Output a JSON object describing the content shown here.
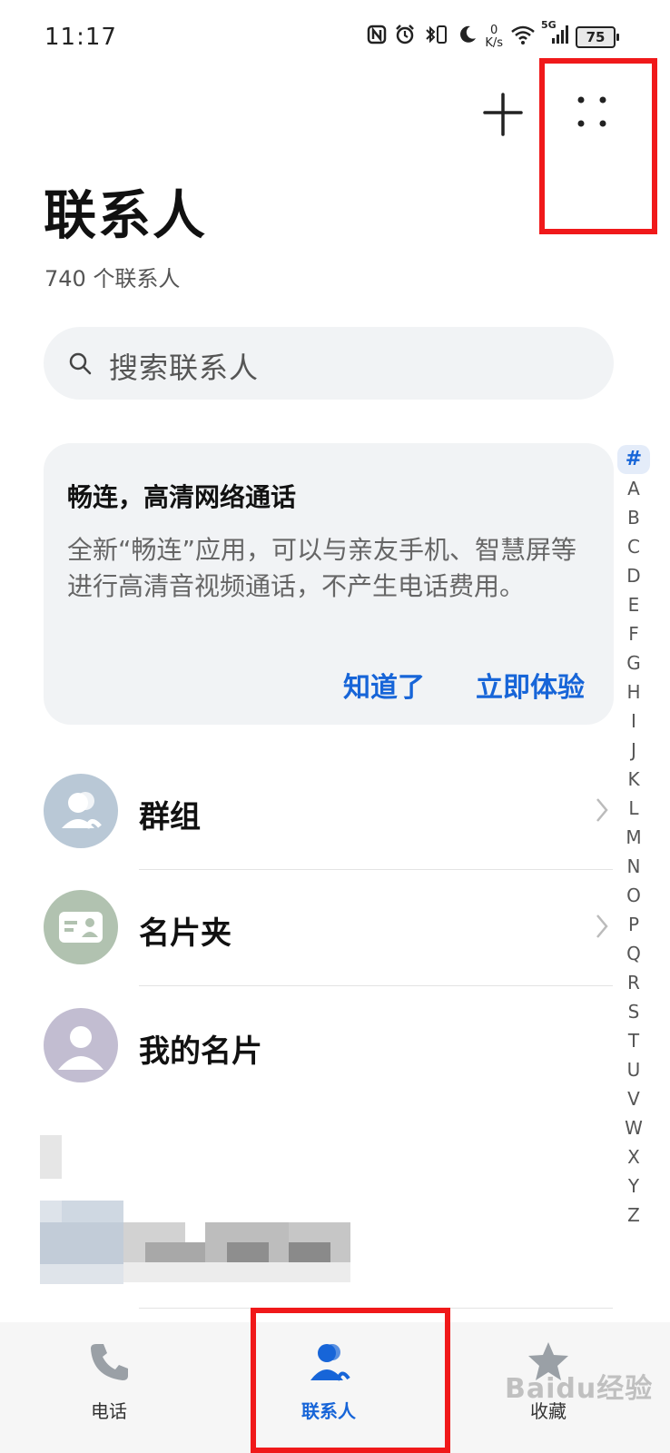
{
  "status_bar": {
    "time": "11:17",
    "net_speed_value": "0",
    "net_speed_unit": "K/s",
    "signal_label": "5G",
    "battery": "75"
  },
  "header": {
    "title": "联系人",
    "subtitle": "740 个联系人",
    "add_icon": "plus-icon",
    "more_icon": "more-icon"
  },
  "search": {
    "placeholder": "搜索联系人"
  },
  "promo_card": {
    "title": "畅连，高清网络通话",
    "body": "全新“畅连”应用，可以与亲友手机、智慧屏等进行高清音视频通话，不产生电话费用。",
    "dismiss_label": "知道了",
    "try_label": "立即体验"
  },
  "alpha_index": [
    "#",
    "A",
    "B",
    "C",
    "D",
    "E",
    "F",
    "G",
    "H",
    "I",
    "J",
    "K",
    "L",
    "M",
    "N",
    "O",
    "P",
    "Q",
    "R",
    "S",
    "T",
    "U",
    "V",
    "W",
    "X",
    "Y",
    "Z"
  ],
  "list": {
    "groups": "群组",
    "business_cards": "名片夹",
    "my_card": "我的名片"
  },
  "bottom_nav": {
    "phone": "电话",
    "contacts": "联系人",
    "favorites": "收藏"
  },
  "watermark": "Baidu经验",
  "colors": {
    "accent": "#1765d8",
    "highlight": "#f0191a",
    "surface": "#f1f3f5"
  }
}
